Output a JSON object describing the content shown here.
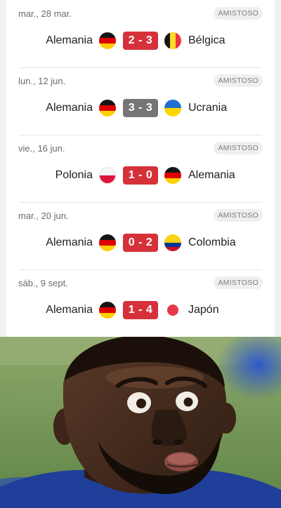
{
  "matches": [
    {
      "date": "mar., 28 mar.",
      "badge": "AMISTOSO",
      "home": "Alemania",
      "home_flag": "germany-flag",
      "score": "2 - 3",
      "result": "loss",
      "away": "Bélgica",
      "away_flag": "belgium-flag"
    },
    {
      "date": "lun., 12 jun.",
      "badge": "AMISTOSO",
      "home": "Alemania",
      "home_flag": "germany-flag",
      "score": "3 - 3",
      "result": "draw",
      "away": "Ucrania",
      "away_flag": "ukraine-flag"
    },
    {
      "date": "vie., 16 jun.",
      "badge": "AMISTOSO",
      "home": "Polonia",
      "home_flag": "poland-flag",
      "score": "1 - 0",
      "result": "loss",
      "away": "Alemania",
      "away_flag": "germany-flag"
    },
    {
      "date": "mar., 20 jun.",
      "badge": "AMISTOSO",
      "home": "Alemania",
      "home_flag": "germany-flag",
      "score": "0 - 2",
      "result": "loss",
      "away": "Colombia",
      "away_flag": "colombia-flag"
    },
    {
      "date": "sáb., 9 sept.",
      "badge": "AMISTOSO",
      "home": "Alemania",
      "home_flag": "germany-flag",
      "score": "1 - 4",
      "result": "loss",
      "away": "Japón",
      "away_flag": "japan-flag"
    }
  ],
  "colors": {
    "loss": "#d6313a",
    "draw": "#757575",
    "jersey": "#1f3f9a"
  },
  "photo": {
    "subject": "surprised-player-reaction"
  }
}
